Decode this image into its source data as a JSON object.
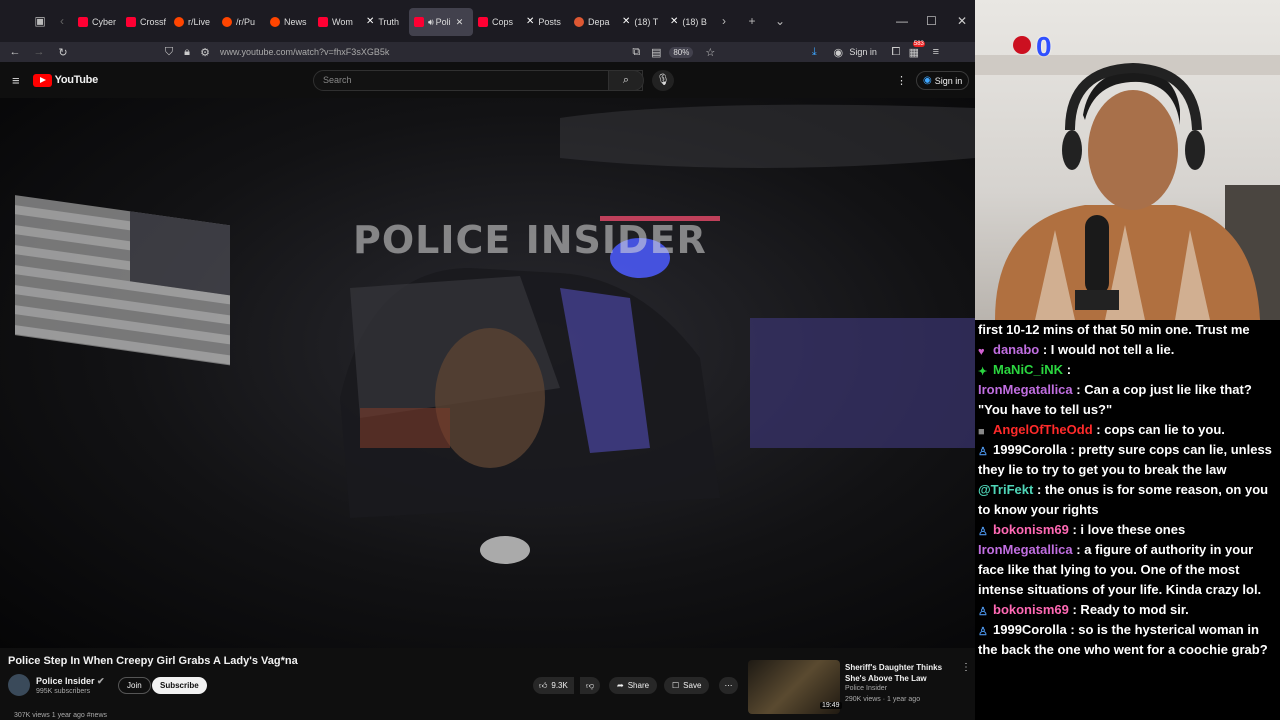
{
  "browser": {
    "tabs": [
      {
        "label": "Cyber",
        "icon": "youtube-favicon"
      },
      {
        "label": "Crossf",
        "icon": "youtube-favicon"
      },
      {
        "label": "r/Live",
        "icon": "reddit-favicon"
      },
      {
        "label": "/r/Pu",
        "icon": "reddit-favicon"
      },
      {
        "label": "News",
        "icon": "reddit-favicon"
      },
      {
        "label": "Wom",
        "icon": "youtube-favicon"
      },
      {
        "label": "Truth",
        "icon": "x-favicon"
      },
      {
        "label": "Poli",
        "icon": "youtube-favicon",
        "active": true
      },
      {
        "label": "Cops",
        "icon": "youtube-favicon"
      },
      {
        "label": "Posts",
        "icon": "x-favicon"
      },
      {
        "label": "Depa",
        "icon": "duckduckgo-favicon"
      },
      {
        "label": "(18) T",
        "icon": "x-favicon"
      },
      {
        "label": "(18) B",
        "icon": "x-favicon"
      }
    ],
    "url": "www.youtube.com/watch?v=fhxF3sXGB5k",
    "zoom": "80%",
    "signin_label": "Sign in",
    "downloads_badge": "583"
  },
  "youtube": {
    "logo_text": "YouTube",
    "search_placeholder": "Search",
    "signin_label": "Sign in",
    "video": {
      "watermark": "POLICE INSIDER",
      "title": "Police Step In When Creepy Girl Grabs A Lady's Vag*na",
      "channel": "Police Insider",
      "subscribers": "995K subscribers",
      "join_label": "Join",
      "subscribe_label": "Subscribe",
      "likes": "9.3K",
      "share_label": "Share",
      "save_label": "Save",
      "views_line": "307K views  1 year ago  #news"
    },
    "recommended": {
      "title": "Sheriff's Daughter Thinks She's Above The Law",
      "channel": "Police Insider",
      "meta": "290K views · 1 year ago",
      "duration": "19:49"
    }
  },
  "stream": {
    "overlay_text": "0"
  },
  "chat": {
    "messages": [
      {
        "user": "",
        "text": "first 10-12 mins of that 50 min one. Trust me",
        "color": "#ffffff",
        "badge": ""
      },
      {
        "user": "danabo",
        "text": ": I would not tell a lie.",
        "color": "#c06ee0",
        "badge": "heart-badge"
      },
      {
        "user": "MaNiC_iNK",
        "text": ":",
        "color": "#2bd640",
        "badge": "star-badge"
      },
      {
        "user": "IronMegatallica",
        "text": ": Can a cop just lie like that? \"You have to tell us?\"",
        "color": "#c06ee0",
        "badge": ""
      },
      {
        "user": "AngelOfTheOdd",
        "text": ": cops can lie to you.",
        "color": "#ff2a2a",
        "badge": "square-badge"
      },
      {
        "user": "1999Corolla",
        "text": ": pretty sure cops can lie, unless they lie to try to get you to break the law",
        "color": "#ffffff",
        "badge": "user-badge"
      },
      {
        "user": "@TriFekt",
        "text": ": the onus is for some reason, on you to know your rights",
        "color": "#4fd6b8",
        "badge": ""
      },
      {
        "user": "bokonism69",
        "text": ": i love these ones",
        "color": "#ff69b4",
        "badge": "user-badge"
      },
      {
        "user": "IronMegatallica",
        "text": ": a figure of authority in your face like that lying to you. One of the most intense situations of your life. Kinda crazy lol.",
        "color": "#c06ee0",
        "badge": ""
      },
      {
        "user": "bokonism69",
        "text": ": Ready to mod sir.",
        "color": "#ff69b4",
        "badge": "user-badge"
      },
      {
        "user": "1999Corolla",
        "text": ": so is the hysterical woman in the back the one who went for a coochie grab?",
        "color": "#ffffff",
        "badge": "user-badge"
      }
    ]
  }
}
